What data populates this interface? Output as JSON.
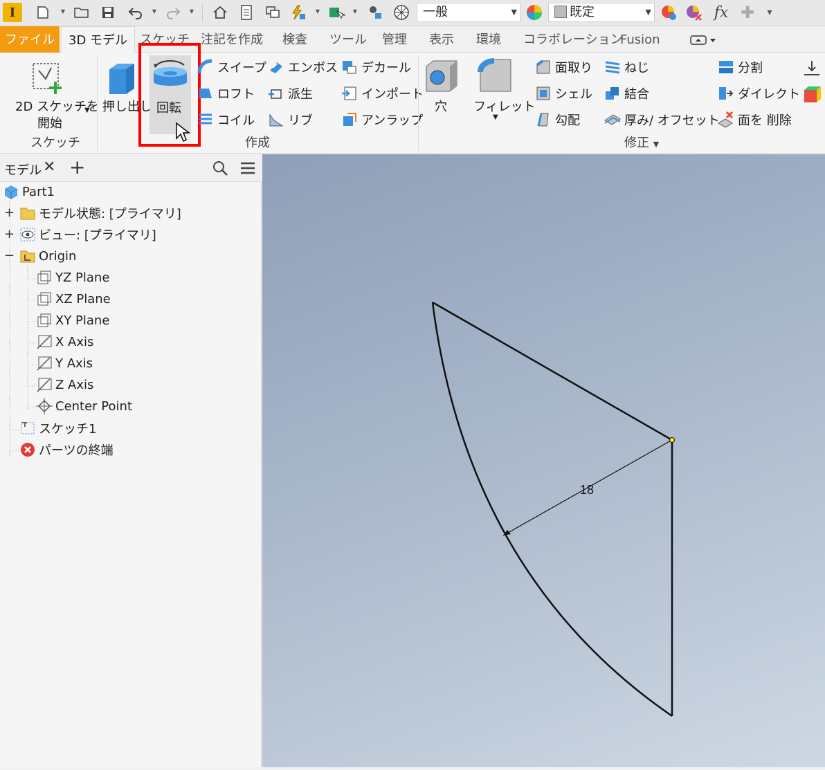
{
  "qat": {
    "appearance_combo": "一般",
    "material_combo": "既定"
  },
  "tabs": [
    "ファイル",
    "3D モデル",
    "スケッチ",
    "注記を作成",
    "検査",
    "ツール",
    "管理",
    "表示",
    "環境",
    "コラボレーション",
    "Fusion"
  ],
  "ribbon": {
    "sketch_btn": "2D スケッチを",
    "sketch_btn2": "開始",
    "extrude": "押し出し",
    "revolve": "回転",
    "sweep": "スイープ",
    "loft": "ロフト",
    "coil": "コイル",
    "emboss": "エンボス",
    "derive": "派生",
    "rib": "リブ",
    "decal": "デカール",
    "import": "インポート",
    "unwrap": "アンラップ",
    "hole": "穴",
    "fillet": "フィレット",
    "chamfer": "面取り",
    "shell": "シェル",
    "draft": "勾配",
    "thread": "ねじ",
    "combine": "結合",
    "thicken": "厚み/ オフセット",
    "split": "分割",
    "direct": "ダイレクト",
    "delete_face": "面を 削除",
    "groups": {
      "sketch": "スケッチ",
      "create": "作成",
      "modify": "修正"
    }
  },
  "browser": {
    "title": "モデル",
    "items": [
      {
        "label": "Part1"
      },
      {
        "label": "モデル状態: [プライマリ]"
      },
      {
        "label": "ビュー: [プライマリ]"
      },
      {
        "label": "Origin"
      },
      {
        "label": "YZ Plane"
      },
      {
        "label": "XZ Plane"
      },
      {
        "label": "XY Plane"
      },
      {
        "label": "X Axis"
      },
      {
        "label": "Y Axis"
      },
      {
        "label": "Z Axis"
      },
      {
        "label": "Center Point"
      },
      {
        "label": "スケッチ1"
      },
      {
        "label": "パーツの終端"
      }
    ]
  },
  "sketch": {
    "dimension": "18"
  },
  "colors": {
    "file_tab": "#f39c12",
    "highlight": "#ff0000",
    "accent_blue": "#3b8fdc"
  }
}
